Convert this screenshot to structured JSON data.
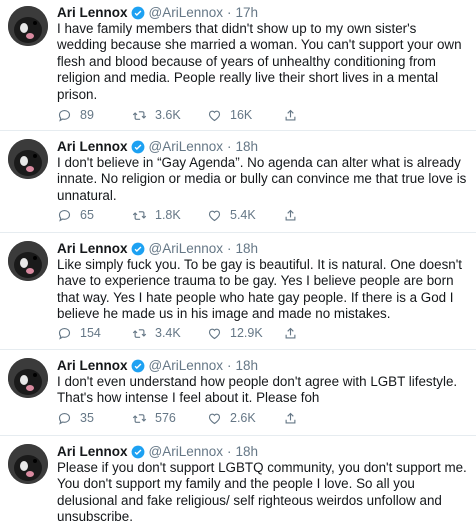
{
  "tweets": [
    {
      "name": "Ari Lennox",
      "handle": "@AriLennox",
      "dot": "·",
      "time": "17h",
      "text": "I have family members that didn't show up to my own sister's wedding because she married a woman. You can't support your own flesh and blood because of years of unhealthy conditioning from religion and media. People really live their short lives in a mental prison.",
      "replies": "89",
      "retweets": "3.6K",
      "likes": "16K"
    },
    {
      "name": "Ari Lennox",
      "handle": "@AriLennox",
      "dot": "·",
      "time": "18h",
      "text": "I don't believe in “Gay Agenda”. No agenda can alter what is already innate. No religion or media or bully can convince me that true love is unnatural.",
      "replies": "65",
      "retweets": "1.8K",
      "likes": "5.4K"
    },
    {
      "name": "Ari Lennox",
      "handle": "@AriLennox",
      "dot": "·",
      "time": "18h",
      "text": "Like simply fuck you. To be gay is beautiful. It is natural. One doesn't have to experience trauma to be gay. Yes I believe people are born that way. Yes I hate people who hate gay people. If there is a God I believe he made us in his image and made no mistakes.",
      "replies": "154",
      "retweets": "3.4K",
      "likes": "12.9K"
    },
    {
      "name": "Ari Lennox",
      "handle": "@AriLennox",
      "dot": "·",
      "time": "18h",
      "text": "I don't even understand how people don't agree with LGBT lifestyle. That's how intense I feel about it. Please foh",
      "replies": "35",
      "retweets": "576",
      "likes": "2.6K"
    },
    {
      "name": "Ari Lennox",
      "handle": "@AriLennox",
      "dot": "·",
      "time": "18h",
      "text": "Please if you don't support LGBTQ community, you don't support me. You don't support my family and the people I love. So all you delusional and fake religious/ self righteous weirdos unfollow and unsubscribe.",
      "replies": "",
      "retweets": "",
      "likes": ""
    }
  ],
  "icons": {
    "avatar": "avatar-photo",
    "verified": "verified-badge-icon",
    "reply": "reply-icon",
    "retweet": "retweet-icon",
    "like": "heart-icon",
    "share": "share-icon"
  },
  "colors": {
    "text": "#14171a",
    "secondary": "#657786",
    "verified": "#1da1f2",
    "divider": "#e6ecf0"
  }
}
